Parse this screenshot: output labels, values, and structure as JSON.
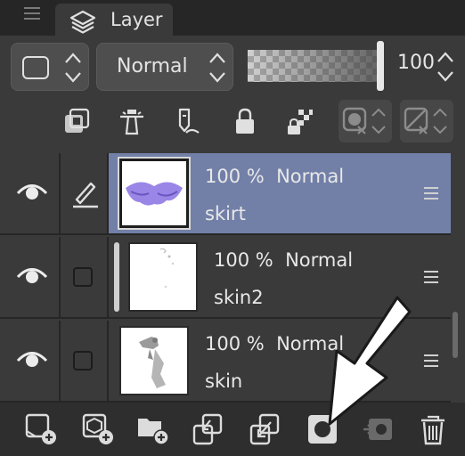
{
  "panel": {
    "tab_label": "Layer",
    "icons": {
      "tab": "layers-icon",
      "menu": "panel-menu-icon"
    }
  },
  "blend": {
    "mode": "Normal",
    "opacity": "100",
    "opacity_level": 1.0
  },
  "tools": [
    "new-layer-mask-icon",
    "reference-layer-icon",
    "selection-draw-icon",
    "lock-layer-icon",
    "lock-transparent-icon",
    "mask-enable-icon",
    "ruler-enable-icon"
  ],
  "layers": [
    {
      "opacity": "100 %",
      "mode": "Normal",
      "name": "skirt",
      "selected": true,
      "editing": true,
      "clipped": false
    },
    {
      "opacity": "100 %",
      "mode": "Normal",
      "name": "skin2",
      "selected": false,
      "editing": false,
      "clipped": true
    },
    {
      "opacity": "100 %",
      "mode": "Normal",
      "name": "skin",
      "selected": false,
      "editing": false,
      "clipped": false
    }
  ],
  "bottom_actions": [
    "new-raster-layer-icon",
    "new-vector-layer-icon",
    "new-folder-icon",
    "transfer-to-lower-icon",
    "combine-with-lower-icon",
    "create-mask-icon",
    "apply-mask-icon",
    "delete-layer-icon"
  ],
  "colors": {
    "selected_row": "#7280a8",
    "panel_bg": "#3a3a3a",
    "arrow_fill": "#ffffff"
  }
}
